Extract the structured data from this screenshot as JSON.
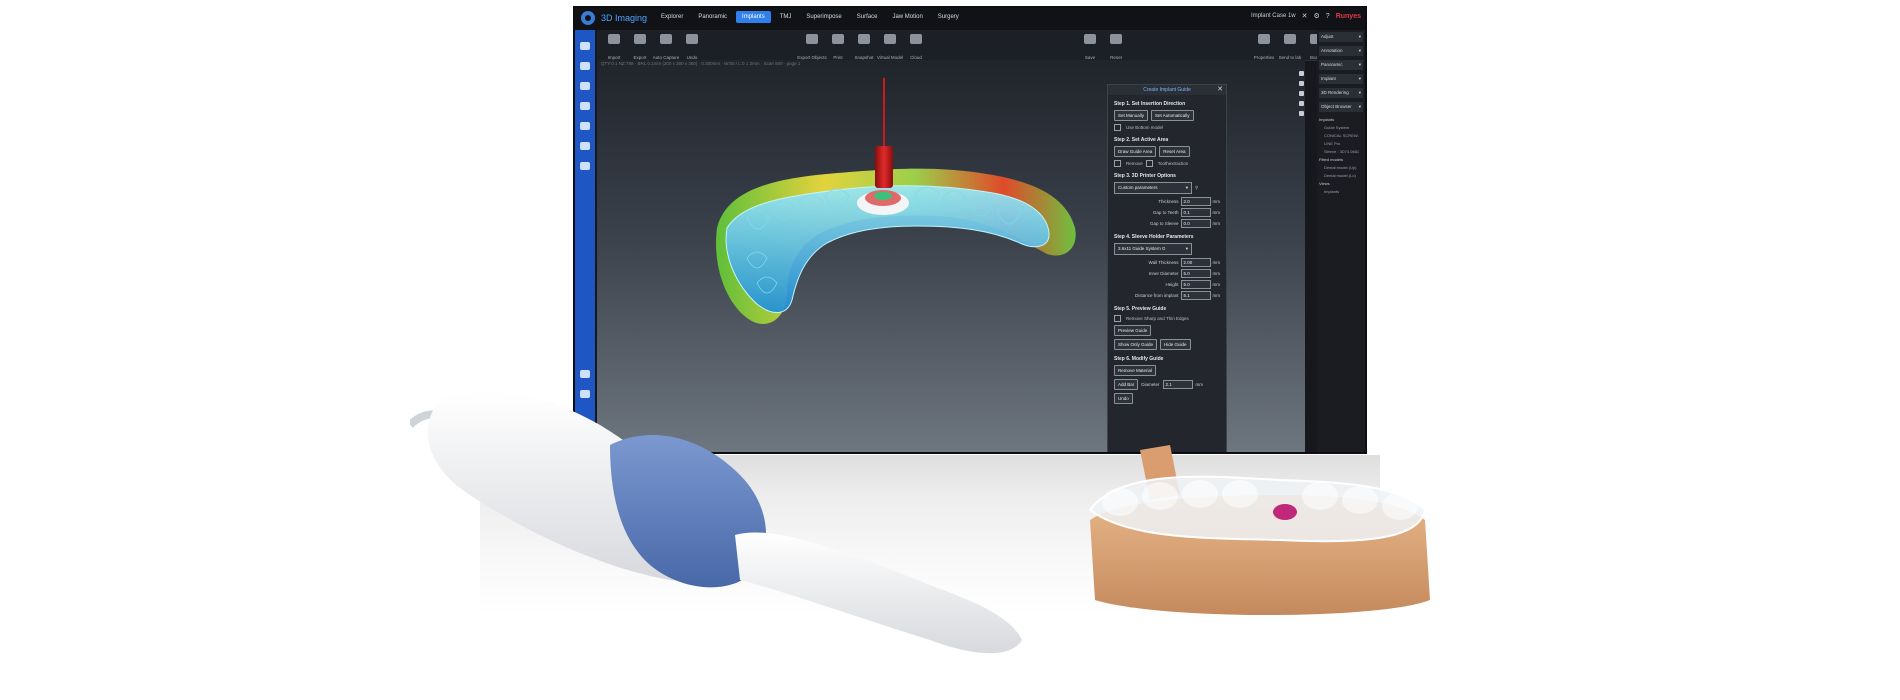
{
  "app": {
    "name": "3D Imaging",
    "case_name": "Implant Case 1w",
    "brand": "Runyes",
    "window_icons": [
      "search-icon",
      "settings-icon",
      "help-icon"
    ]
  },
  "menu": [
    "Explorer",
    "Panoramic",
    "Implants",
    "TMJ",
    "Superimpose",
    "Surface",
    "Jaw Motion",
    "Surgery"
  ],
  "toolbar": {
    "left": [
      "Import",
      "Export",
      "Auto Capture",
      "Undo"
    ],
    "center": [
      "Export Objects",
      "Print",
      "Snapshot",
      "Virtual Model",
      "Cloud"
    ],
    "mid_right": [
      "Save",
      "Reset"
    ],
    "right": [
      "Properties",
      "Send to lab",
      "Board"
    ]
  },
  "viewport_info": "QTY:0.1 NZ:788 · BRL 0.1mm (200 x 300 x 350) · 0.300mm · W:50 / L:0 1 2mm · Scan 500 · page 1",
  "guide_panel": {
    "title": "Create Implant Guide",
    "step1": {
      "title": "Step 1. Set Insertion Direction",
      "buttons": [
        "Set Manually",
        "Set Automatically"
      ],
      "checkbox": "Use Bottom model"
    },
    "step2": {
      "title": "Step 2. Set Active Area",
      "buttons": [
        "Draw Guide Area",
        "Reset Area"
      ],
      "checkboxes": [
        "Remove",
        "Toothextraction"
      ]
    },
    "step3": {
      "title": "Step 3. 3D Printer Options",
      "select": "Custom parameters",
      "params": [
        {
          "label": "Thickness",
          "value": "2.0",
          "unit": "mm"
        },
        {
          "label": "Gap to Teeth",
          "value": "0.1",
          "unit": "mm"
        },
        {
          "label": "Gap to Sleeve",
          "value": "0.0",
          "unit": "mm"
        }
      ]
    },
    "step4": {
      "title": "Step 4. Sleeve Holder Parameters",
      "select": "3.6x11 Guide System G",
      "params": [
        {
          "label": "Wall Thickness",
          "value": "2.00",
          "unit": "mm"
        },
        {
          "label": "Inner Diameter",
          "value": "5.0",
          "unit": "mm"
        },
        {
          "label": "Height",
          "value": "5.0",
          "unit": "mm"
        },
        {
          "label": "Distance from implant",
          "value": "5.1",
          "unit": "mm"
        }
      ]
    },
    "step5": {
      "title": "Step 5. Preview Guide",
      "checkbox": "Remove Sharp and Thin Edges",
      "buttons": [
        "Preview Guide",
        "Show Only Guide",
        "Hide Guide"
      ]
    },
    "step6": {
      "title": "Step 6. Modify Guide",
      "button": "Remove Material",
      "param": {
        "label": "Diameter",
        "value": "2.1",
        "unit": "mm"
      },
      "buttons": [
        "Add Bar",
        "Undo"
      ]
    }
  },
  "right_panel": {
    "sections": [
      "Adjust",
      "Annotation",
      "Panoramic",
      "Implant",
      "3D Rendering",
      "Object Browser"
    ],
    "tree": [
      "Implants",
      "Guide System CONICAL SCREW-LINE Pro",
      "Sleeve : 3D74.0661",
      "Fitted models",
      "Dental model (Up)",
      "Dental model (Lo)",
      "Views",
      "Implants"
    ]
  },
  "colors": {
    "accent": "#2f80ed",
    "sidebar": "#1e56c4",
    "brand": "#e0394b",
    "scanner_band": "#5f80c1",
    "model_cast": "#d8a377",
    "mesh_teal": "#38c7e0",
    "drill_red": "#cc1a1a"
  }
}
